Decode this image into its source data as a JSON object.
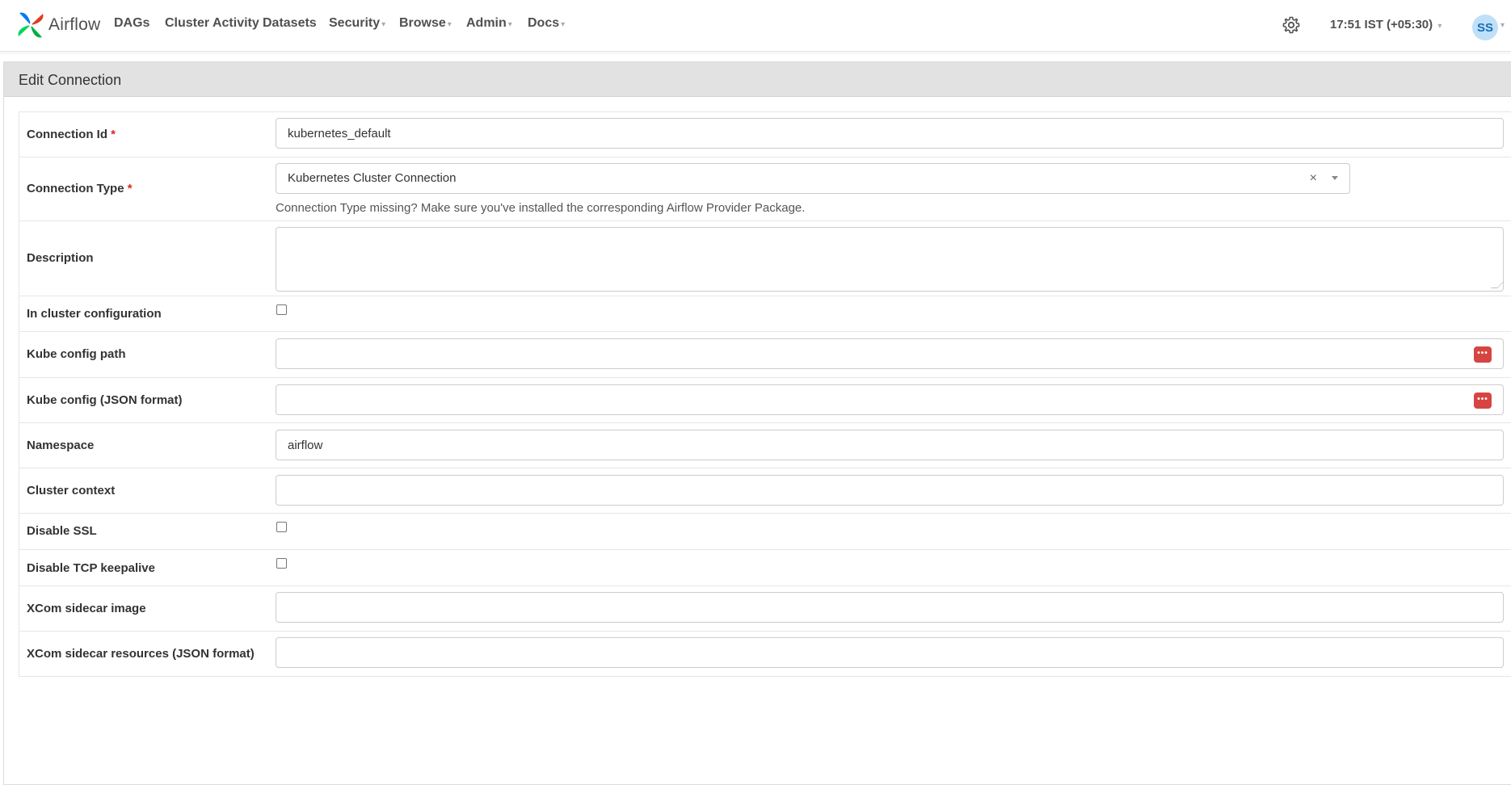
{
  "brand": {
    "name": "Airflow",
    "logo_icon": "airflow-pinwheel-logo"
  },
  "nav": {
    "items": [
      {
        "label": "DAGs",
        "dropdown": false
      },
      {
        "label": "Cluster Activity",
        "dropdown": false
      },
      {
        "label": "Datasets",
        "dropdown": false
      },
      {
        "label": "Security",
        "dropdown": true
      },
      {
        "label": "Browse",
        "dropdown": true
      },
      {
        "label": "Admin",
        "dropdown": true
      },
      {
        "label": "Docs",
        "dropdown": true
      }
    ],
    "settings_icon": "gear-icon",
    "clock": "17:51 IST (+05:30)",
    "user_initials": "SS"
  },
  "panel": {
    "title": "Edit Connection"
  },
  "form": {
    "connection_id": {
      "label": "Connection Id",
      "required": "*",
      "value": "kubernetes_default"
    },
    "connection_type": {
      "label": "Connection Type",
      "required": "*",
      "selected": "Kubernetes Cluster Connection",
      "clear_symbol": "×",
      "help": "Connection Type missing? Make sure you've installed the corresponding Airflow Provider Package."
    },
    "description": {
      "label": "Description",
      "value": ""
    },
    "in_cluster": {
      "label": "In cluster configuration",
      "checked": false
    },
    "kube_config_path": {
      "label": "Kube config path",
      "value": ""
    },
    "kube_config_json": {
      "label": "Kube config (JSON format)",
      "value": ""
    },
    "namespace": {
      "label": "Namespace",
      "value": "airflow"
    },
    "cluster_context": {
      "label": "Cluster context",
      "value": ""
    },
    "disable_ssl": {
      "label": "Disable SSL",
      "checked": false
    },
    "disable_tcp_keepalive": {
      "label": "Disable TCP keepalive",
      "checked": false
    },
    "xcom_sidecar_image": {
      "label": "XCom sidecar image",
      "value": ""
    },
    "xcom_sidecar_resources": {
      "label": "XCom sidecar resources (JSON format)",
      "value": ""
    }
  },
  "colors": {
    "required_marker": "#d9291c",
    "password_manager_icon": "#d64541",
    "panel_heading_bg": "#e2e2e2",
    "avatar_bg": "#bfe0f8"
  }
}
